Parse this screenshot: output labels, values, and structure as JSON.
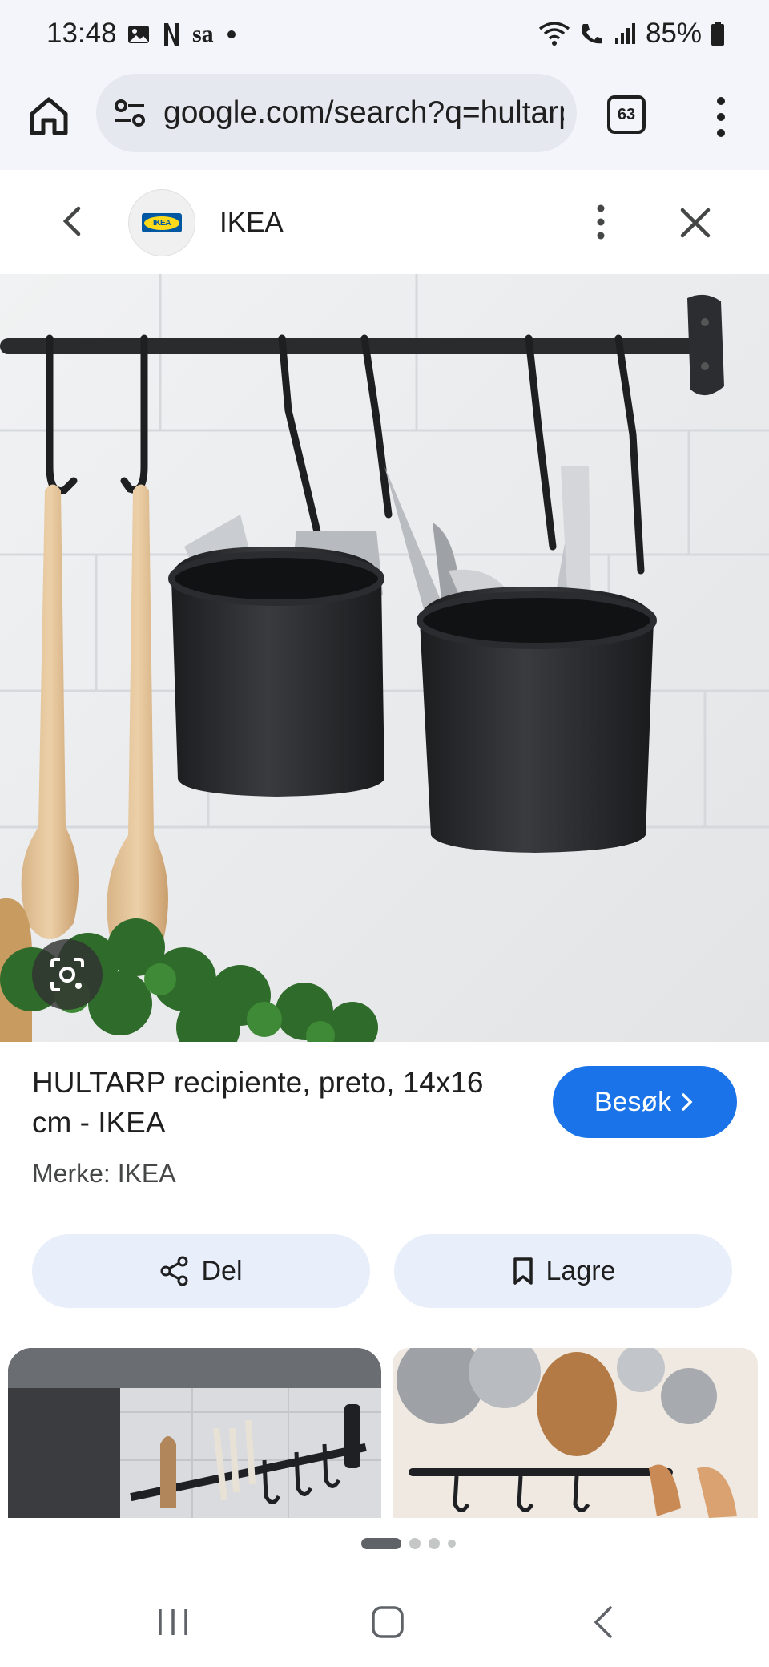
{
  "status_bar": {
    "time": "13:48",
    "carrier_text": "sa",
    "battery": "85%",
    "icons": [
      "image-icon",
      "netflix-icon",
      "dot-icon",
      "wifi-icon",
      "wifi-calling-icon",
      "signal-icon",
      "battery-icon"
    ]
  },
  "browser": {
    "url": "google.com/search?q=hultarp",
    "tab_count": "63"
  },
  "panel": {
    "site_name": "IKEA",
    "logo_text": "IKEA"
  },
  "result": {
    "title": "HULTARP recipiente, preto, 14x16 cm - IKEA",
    "visit_label": "Besøk",
    "brand_line": "Merke: IKEA",
    "share_label": "Del",
    "save_label": "Lagre"
  },
  "colors": {
    "accent": "#1a73e8",
    "chip_bg": "#e8eefa",
    "toolbar_bg": "#f4f5fb"
  }
}
